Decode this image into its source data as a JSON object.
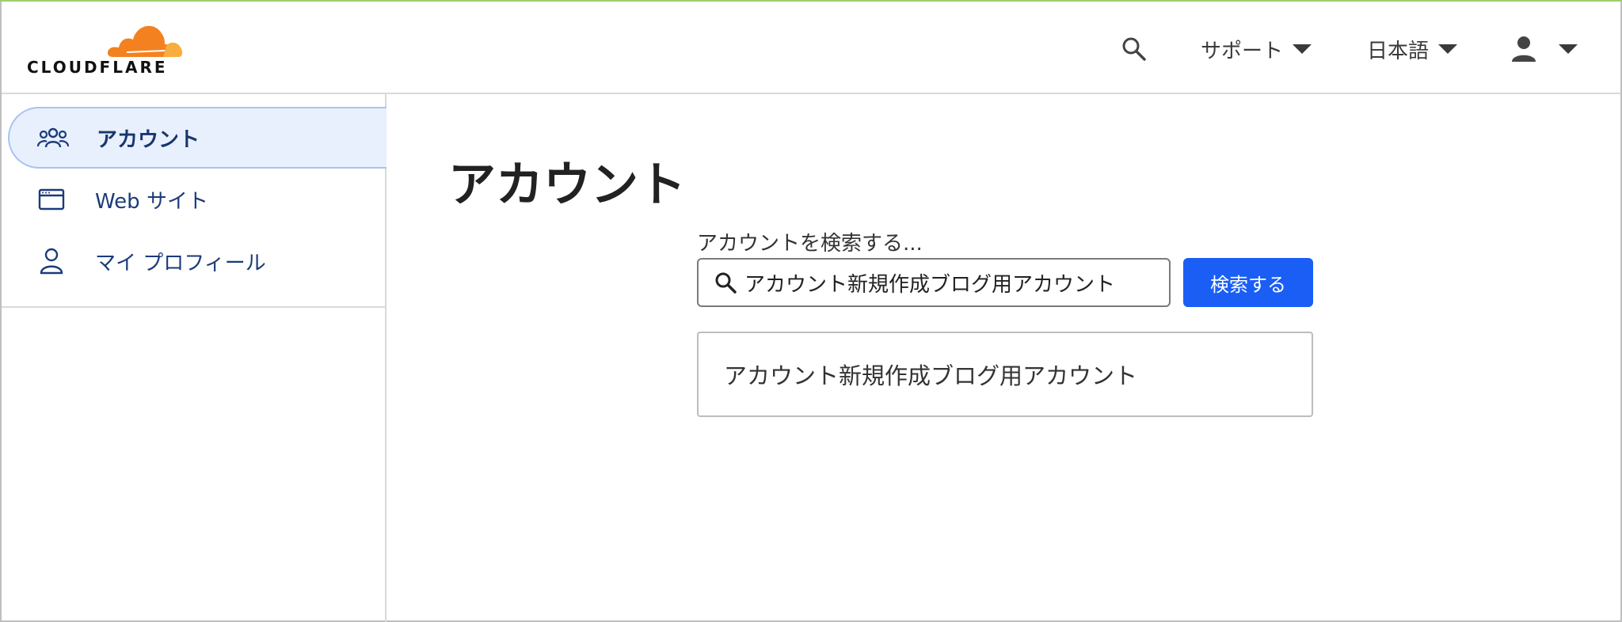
{
  "header": {
    "logo_text": "CLOUDFLARE",
    "support_label": "サポート",
    "language_label": "日本語"
  },
  "sidebar": {
    "items": [
      {
        "label": "アカウント",
        "icon": "users-icon",
        "active": true
      },
      {
        "label": "Web サイト",
        "icon": "browser-window-icon",
        "active": false
      },
      {
        "label": "マイ プロフィール",
        "icon": "user-icon",
        "active": false
      }
    ]
  },
  "main": {
    "title": "アカウント",
    "search": {
      "label": "アカウントを検索する...",
      "value": "アカウント新規作成ブログ用アカウント",
      "button_label": "検索する"
    },
    "results": [
      {
        "name": "アカウント新規作成ブログ用アカウント"
      }
    ]
  },
  "colors": {
    "brand_orange": "#f48120",
    "brand_light_orange": "#faad3f",
    "primary_button": "#1a5ef5",
    "sidebar_active_bg": "#e8f0fd",
    "sidebar_text": "#1b3b7a"
  }
}
